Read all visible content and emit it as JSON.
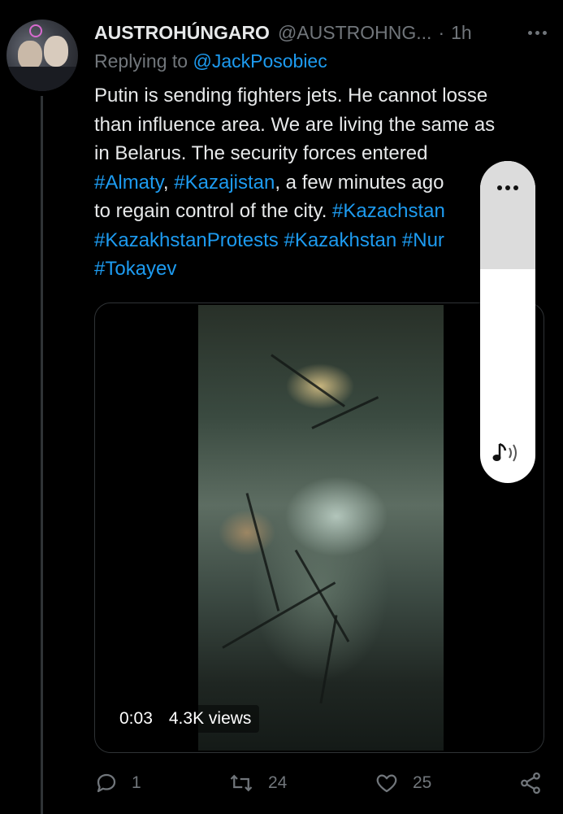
{
  "tweet": {
    "display_name": "AUSTROHÚNGARO",
    "handle": "@AUSTROHNG...",
    "separator": "·",
    "time": "1h",
    "reply_prefix": "Replying to",
    "reply_to": "@JackPosobiec",
    "text": {
      "l1": "Putin is sending fighters jets. He cannot losse",
      "l2": "than influence area. We are living the same as",
      "l3": "in Belarus. The security forces entered",
      "l4_tag1": "#Almaty",
      "l4_sep": ", ",
      "l4_tag2": "#Kazajistan",
      "l4_rest": ", a few minutes ago",
      "l5_text": "to regain control of the city. ",
      "l5_tag": "#Kazachstan",
      "l6_tag1": "#KazakhstanProtests",
      "l6_tag2": "#Kazakhstan",
      "l6_tag3": "#Nur",
      "l7_tag": "#Tokayev"
    }
  },
  "video": {
    "timestamp": "0:03",
    "views": "4.3K views"
  },
  "volume_popup": {
    "more_icon": "more-dots-icon",
    "sound_icon": "sound-icon"
  },
  "actions": {
    "reply_count": "1",
    "retweet_count": "24",
    "like_count": "25"
  },
  "colors": {
    "background": "#000000",
    "text": "#e7e9ea",
    "muted": "#71767b",
    "link": "#1d9bf0"
  }
}
